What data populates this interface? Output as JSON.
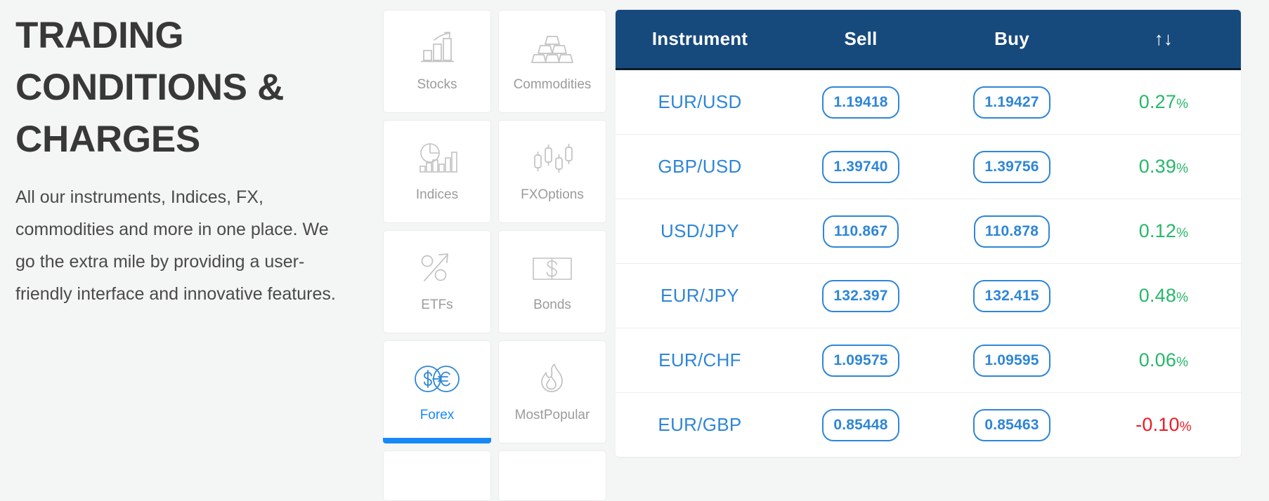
{
  "intro": {
    "title": "TRADING CONDITIONS & CHARGES",
    "body": "All our instruments, Indices, FX, commodities and more in one place. We go the extra mile by providing a user- friendly interface and innovative features."
  },
  "colors": {
    "page_background": "#f4f5f5",
    "header_navy": "#174a7c",
    "accent_blue": "#1789f5",
    "link_blue": "#2e86d6",
    "up_green": "#26b86a",
    "down_red": "#ec1c24",
    "icon_gray": "#bdbdbd",
    "label_gray": "#9b9b9b"
  },
  "categories": [
    {
      "label": "Stocks",
      "icon": "bar-chart-arrow-icon",
      "active": false
    },
    {
      "label": "Commodities",
      "icon": "gold-bars-icon",
      "active": false
    },
    {
      "label": "Indices",
      "icon": "pie-bar-chart-icon",
      "active": false
    },
    {
      "label": "FXOptions",
      "icon": "candlestick-icon",
      "active": false
    },
    {
      "label": "ETFs",
      "icon": "percent-arrow-icon",
      "active": false
    },
    {
      "label": "Bonds",
      "icon": "dollar-bill-icon",
      "active": false
    },
    {
      "label": "Forex",
      "icon": "currency-exchange-icon",
      "active": true
    },
    {
      "label": "MostPopular",
      "icon": "flame-icon",
      "active": false
    }
  ],
  "quotes": {
    "columns": {
      "instrument": "Instrument",
      "sell": "Sell",
      "buy": "Buy",
      "change": "↑↓"
    },
    "change_icon_name": "sort-arrows-icon",
    "rows": [
      {
        "instrument": "EUR/USD",
        "sell": "1.19418",
        "buy": "1.19427",
        "change": "0.27",
        "pct": "%",
        "dir": "up"
      },
      {
        "instrument": "GBP/USD",
        "sell": "1.39740",
        "buy": "1.39756",
        "change": "0.39",
        "pct": "%",
        "dir": "up"
      },
      {
        "instrument": "USD/JPY",
        "sell": "110.867",
        "buy": "110.878",
        "change": "0.12",
        "pct": "%",
        "dir": "up"
      },
      {
        "instrument": "EUR/JPY",
        "sell": "132.397",
        "buy": "132.415",
        "change": "0.48",
        "pct": "%",
        "dir": "up"
      },
      {
        "instrument": "EUR/CHF",
        "sell": "1.09575",
        "buy": "1.09595",
        "change": "0.06",
        "pct": "%",
        "dir": "up"
      },
      {
        "instrument": "EUR/GBP",
        "sell": "0.85448",
        "buy": "0.85463",
        "change": "-0.10",
        "pct": "%",
        "dir": "down"
      }
    ]
  }
}
